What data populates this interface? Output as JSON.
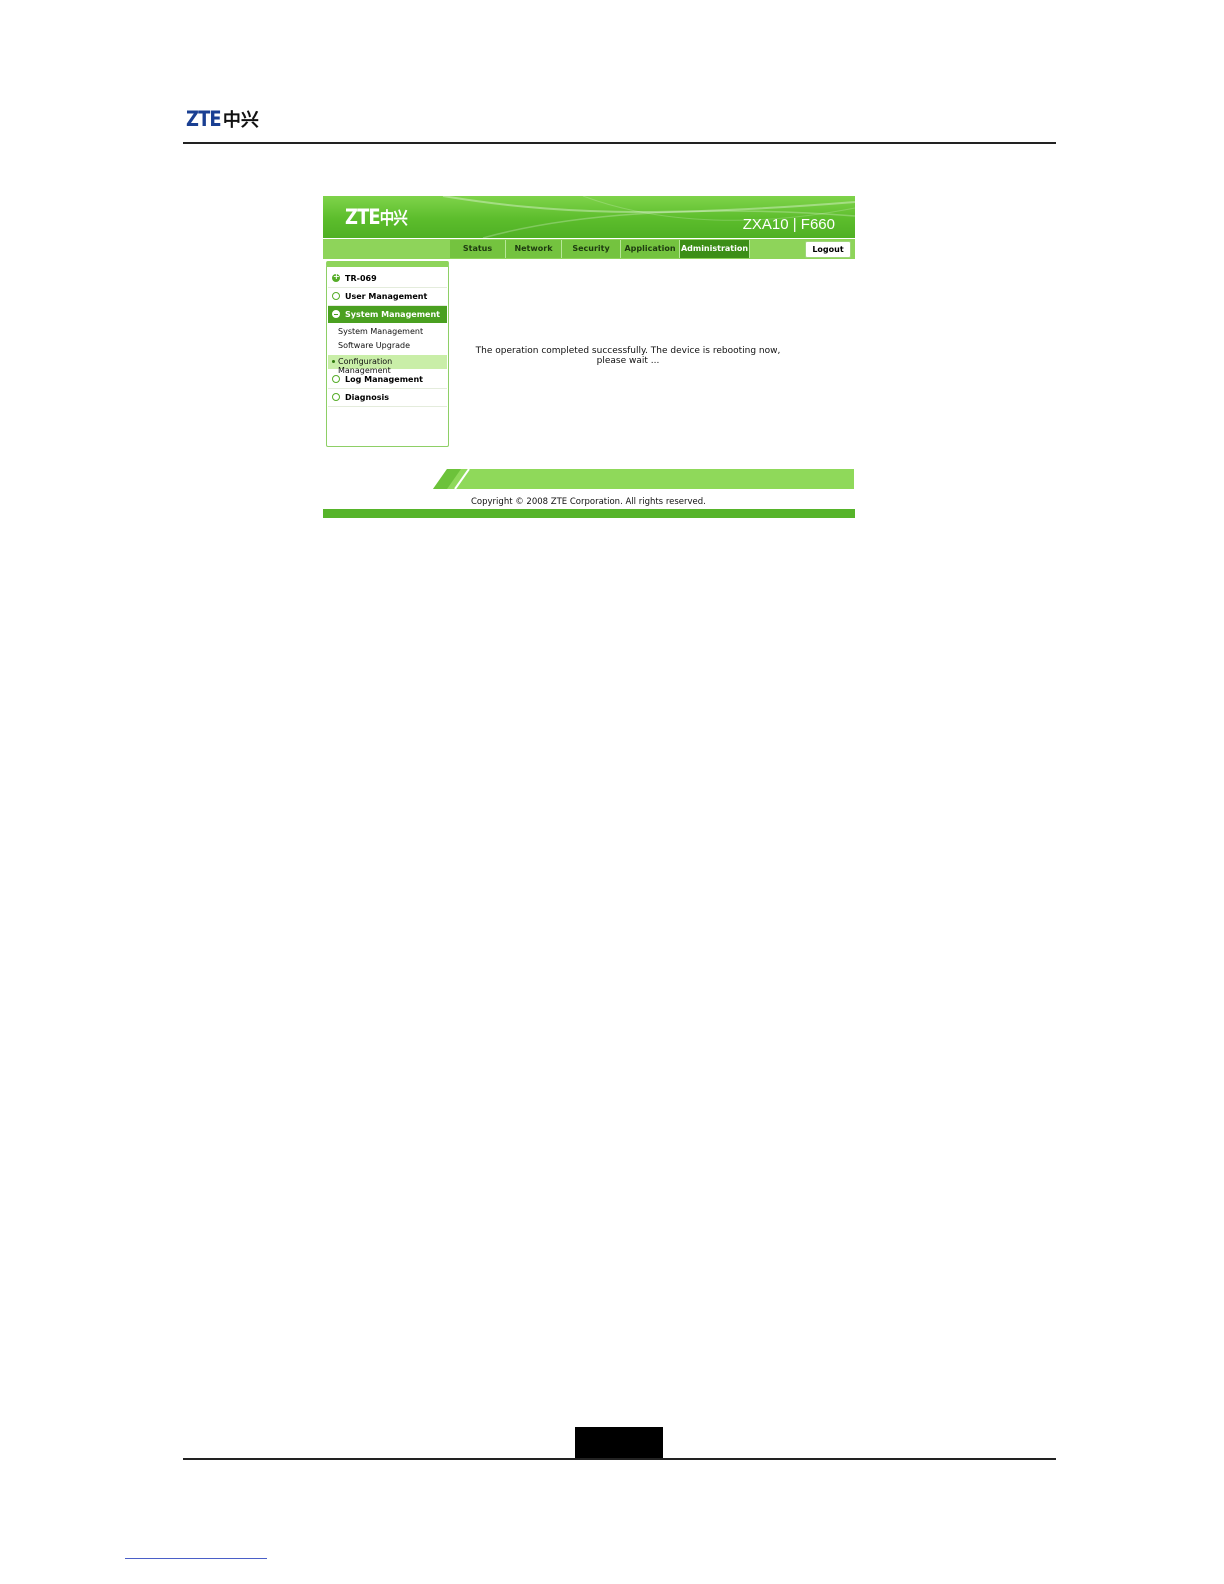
{
  "document": {
    "logo_latin": "ZTE",
    "logo_cjk": "中兴"
  },
  "screenshot": {
    "brand_latin": "ZTE",
    "brand_cjk": "中兴",
    "model": "ZXA10 | F660",
    "colors": {
      "accent": "#56b42a",
      "active_tab": "#3c8f17",
      "logo_blue": "#1a3f92"
    },
    "nav": {
      "tabs": [
        {
          "label": "Status"
        },
        {
          "label": "Network"
        },
        {
          "label": "Security"
        },
        {
          "label": "Application"
        },
        {
          "label": "Administration",
          "active": true
        }
      ],
      "logout_label": "Logout"
    },
    "sidebar": {
      "items": [
        {
          "label": "TR-069",
          "icon": "expand-plus-icon"
        },
        {
          "label": "User Management",
          "icon": "circle-icon"
        },
        {
          "label": "System Management",
          "icon": "collapse-minus-icon",
          "open": true
        }
      ],
      "subitems": [
        {
          "label": "System Management"
        },
        {
          "label": "Software Upgrade"
        },
        {
          "label": "Configuration Management",
          "selected": true
        }
      ],
      "items_after": [
        {
          "label": "Log Management",
          "icon": "circle-icon"
        },
        {
          "label": "Diagnosis",
          "icon": "circle-icon"
        }
      ]
    },
    "message_line1": "The operation completed successfully. The device is rebooting now,",
    "message_line2": "please wait ...",
    "copyright": "Copyright © 2008 ZTE Corporation. All rights reserved."
  }
}
